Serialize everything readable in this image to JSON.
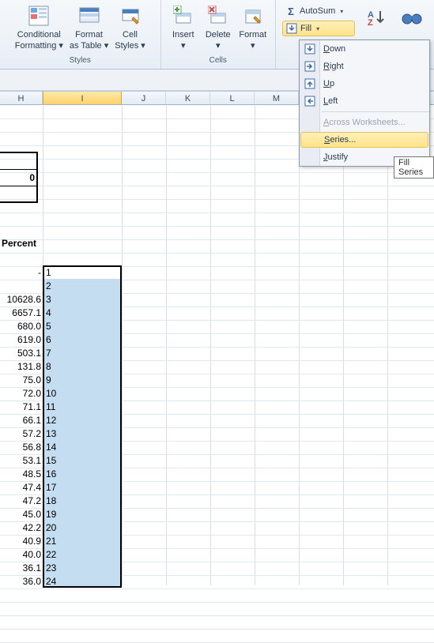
{
  "ribbon": {
    "styles": {
      "group_label": "Styles",
      "cond_fmt_l1": "Conditional",
      "cond_fmt_l2": "Formatting ▾",
      "fmt_tbl_l1": "Format",
      "fmt_tbl_l2": "as Table ▾",
      "cell_sty_l1": "Cell",
      "cell_sty_l2": "Styles ▾"
    },
    "cells": {
      "group_label": "Cells",
      "insert_l1": "Insert",
      "delete_l1": "Delete",
      "format_l1": "Format",
      "drop": "▾"
    },
    "editing": {
      "autosum": "AutoSum",
      "fill": "Fill",
      "sigma": "Σ"
    }
  },
  "fill_menu": {
    "down": "own",
    "right": "ight",
    "up": "p",
    "left": "eft",
    "across": "cross Worksheets...",
    "series": "eries...",
    "justify": "ustify",
    "underline": {
      "d": "D",
      "r": "R",
      "u": "U",
      "l": "L",
      "a": "A",
      "s": "S",
      "j": "J"
    }
  },
  "tooltip": "Fill Series",
  "col_headers": [
    "H",
    "I",
    "J",
    "K",
    "L",
    "M"
  ],
  "early_rows": [
    "",
    "0",
    ""
  ],
  "percent_label": "Percent",
  "h_values": [
    "-",
    "",
    "10628.6",
    "6657.1",
    "680.0",
    "619.0",
    "503.1",
    "131.8",
    "75.0",
    "72.0",
    "71.1",
    "66.1",
    "57.2",
    "56.8",
    "53.1",
    "48.5",
    "47.4",
    "47.2",
    "45.0",
    "42.2",
    "40.9",
    "40.0",
    "36.1",
    "36.0"
  ],
  "i_values": [
    "1",
    "2",
    "3",
    "4",
    "5",
    "6",
    "7",
    "8",
    "9",
    "10",
    "11",
    "12",
    "13",
    "14",
    "15",
    "16",
    "17",
    "18",
    "19",
    "20",
    "21",
    "22",
    "23",
    "24"
  ]
}
